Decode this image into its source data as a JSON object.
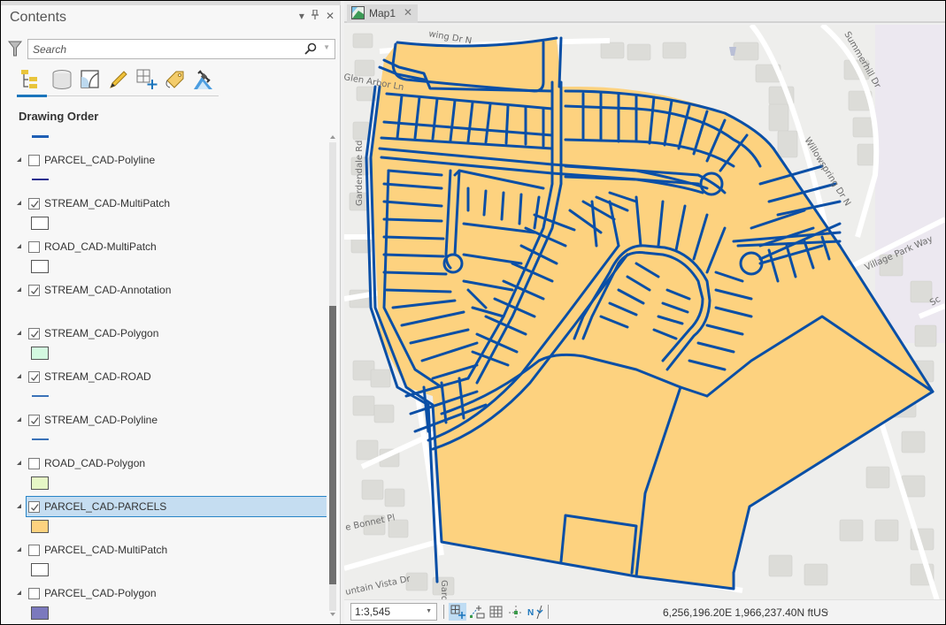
{
  "contents": {
    "title": "Contents",
    "controls": {
      "menu": "▾",
      "pin": "ᚁ",
      "close": "✕"
    },
    "search_placeholder": "Search",
    "tool_tabs": [
      {
        "name": "list-by-drawing-order",
        "active": true
      },
      {
        "name": "list-by-source",
        "active": false
      },
      {
        "name": "list-by-selection",
        "active": false
      },
      {
        "name": "list-by-editing",
        "active": false
      },
      {
        "name": "list-by-snapping",
        "active": false
      },
      {
        "name": "list-by-labeling",
        "active": false
      },
      {
        "name": "list-by-perspective-imagery",
        "active": false
      }
    ],
    "section_header": "Drawing Order",
    "top_swatch_color": "#1f5fb5",
    "layers": [
      {
        "name": "PARCEL_CAD-Polyline",
        "checked": false,
        "selected": false,
        "swatch": {
          "type": "line",
          "color": "#2b2f8f"
        }
      },
      {
        "name": "STREAM_CAD-MultiPatch",
        "checked": true,
        "selected": false,
        "swatch": {
          "type": "box",
          "color": "#ffffff"
        }
      },
      {
        "name": "ROAD_CAD-MultiPatch",
        "checked": false,
        "selected": false,
        "swatch": {
          "type": "box",
          "color": "#ffffff"
        }
      },
      {
        "name": "STREAM_CAD-Annotation",
        "checked": true,
        "selected": false,
        "swatch": {
          "type": "none",
          "color": ""
        }
      },
      {
        "name": "STREAM_CAD-Polygon",
        "checked": true,
        "selected": false,
        "swatch": {
          "type": "box",
          "color": "#d3f9e0"
        }
      },
      {
        "name": "STREAM_CAD-ROAD",
        "checked": true,
        "selected": false,
        "swatch": {
          "type": "line",
          "color": "#3a72b8"
        }
      },
      {
        "name": "STREAM_CAD-Polyline",
        "checked": true,
        "selected": false,
        "swatch": {
          "type": "line",
          "color": "#3a72b8"
        }
      },
      {
        "name": "ROAD_CAD-Polygon",
        "checked": false,
        "selected": false,
        "swatch": {
          "type": "box",
          "color": "#e6f7c6"
        }
      },
      {
        "name": "PARCEL_CAD-PARCELS",
        "checked": true,
        "selected": true,
        "swatch": {
          "type": "box",
          "color": "#fdd27f"
        }
      },
      {
        "name": "PARCEL_CAD-MultiPatch",
        "checked": false,
        "selected": false,
        "swatch": {
          "type": "box",
          "color": "#ffffff"
        }
      },
      {
        "name": "PARCEL_CAD-Polygon",
        "checked": false,
        "selected": false,
        "swatch": {
          "type": "box",
          "color": "#7b79bd"
        }
      }
    ]
  },
  "map": {
    "tab_label": "Map1",
    "tab_close": "✕",
    "parcel_fill": "#fdd27f",
    "parcel_stroke": "#0a4fa6",
    "streets": [
      "Glen Arbor Ln",
      "Willowspring Dr N",
      "Summerhill Dr",
      "Village Park Way",
      "Gardendale Rd",
      "Bonnet Pl",
      "Fountain Vista Dr",
      "Gard",
      "Willowspring Dr N",
      "Sc"
    ],
    "street_labels": {
      "glen_arbor": "Glen Arbor Ln",
      "willowspring_top": "wing Dr N",
      "willowspring": "Willowspring Dr N",
      "summerhill": "Summerhill Dr",
      "village_park": "Village Park Way",
      "gardendale": "Gardendale Rd",
      "bonnet": "e Bonnet Pl",
      "fountain_vista": "untain Vista Dr",
      "gard": "Gard",
      "sc": "Sc"
    }
  },
  "statusbar": {
    "scale": "1:3,545",
    "coordinates": "6,256,196.20E 1,966,237.40N ftUS",
    "coords_dropdown": "⌄",
    "tools": [
      "grid-snap",
      "snapping",
      "grid",
      "guides",
      "north-arrow"
    ]
  }
}
